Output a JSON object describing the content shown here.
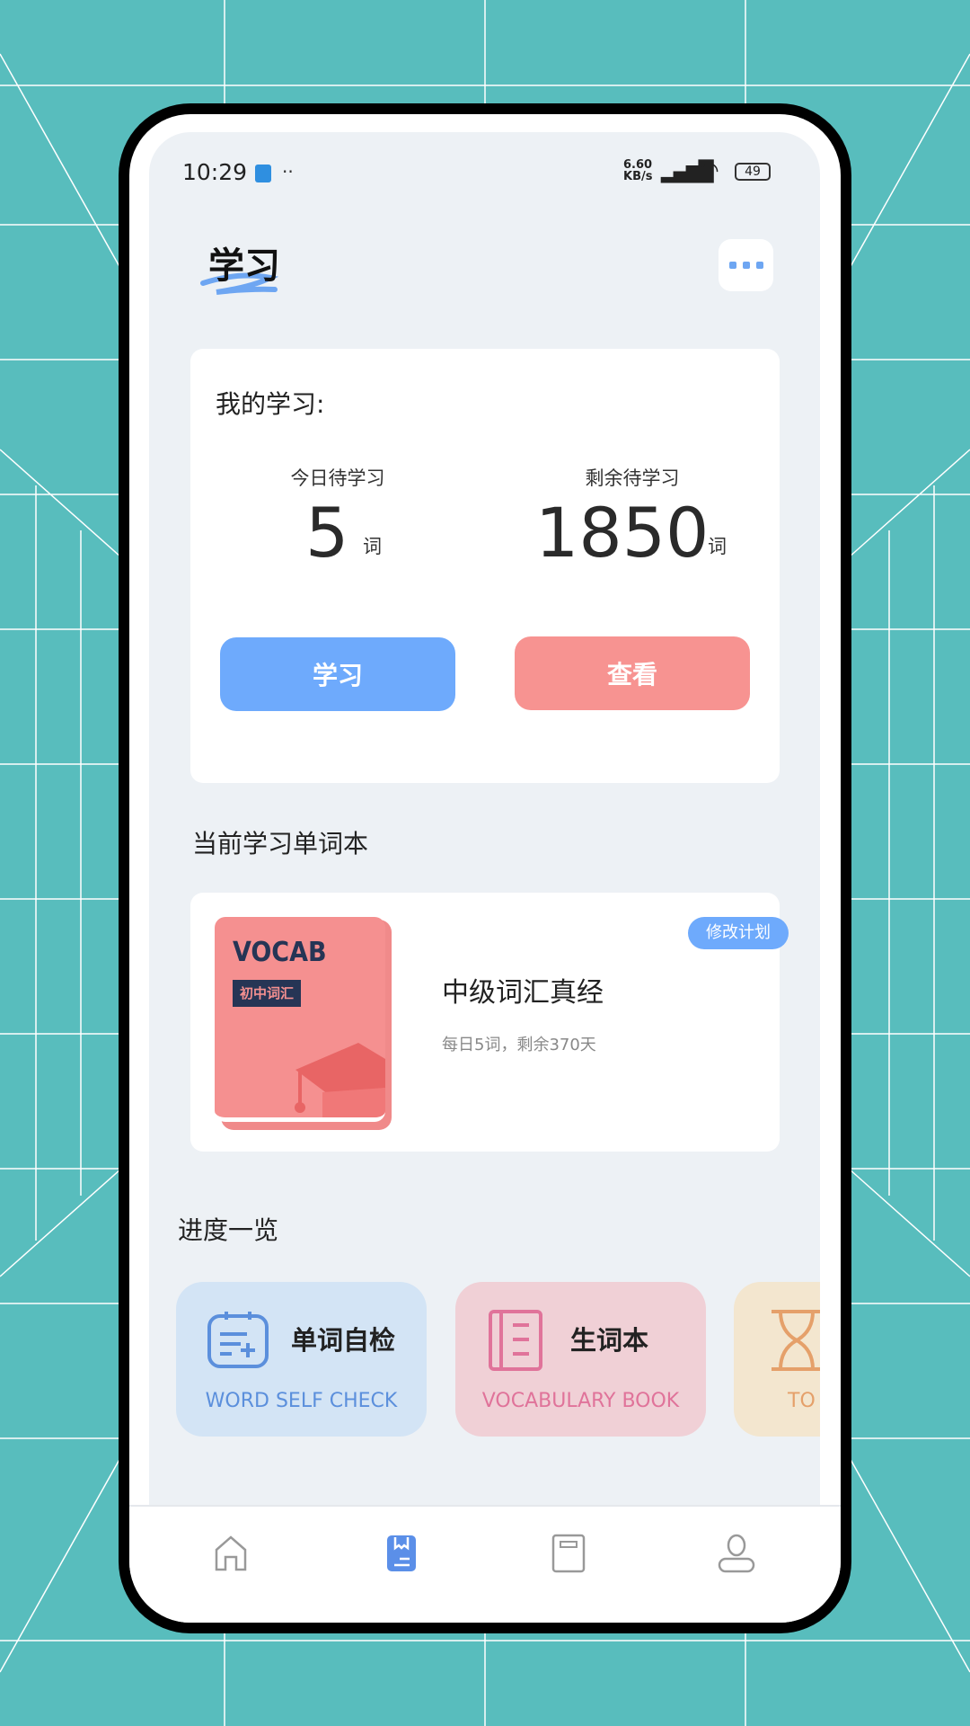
{
  "status_bar": {
    "time": "10:29",
    "speed": "6.60",
    "speed_unit": "KB/s",
    "battery": "49"
  },
  "header": {
    "title": "学习",
    "more_icon": "ellipsis-icon"
  },
  "study": {
    "heading": "我的学习:",
    "today_label": "今日待学习",
    "today_value": "5",
    "today_unit": "词",
    "remain_label": "剩余待学习",
    "remain_value": "1850",
    "remain_unit": "词",
    "study_button": "学习",
    "view_button": "查看"
  },
  "wordbook": {
    "section_title": "当前学习单词本",
    "cover_title": "VOCAB",
    "cover_subtitle": "初中词汇",
    "name": "中级词汇真经",
    "plan": "每日5词，剩余370天",
    "edit_button": "修改计划"
  },
  "progress": {
    "section_title": "进度一览",
    "tiles": [
      {
        "title": "单词自检",
        "subtitle": "WORD SELF CHECK",
        "icon": "calendar-plus-icon",
        "color": "#5b8fdc",
        "bg": "#d3e4f5"
      },
      {
        "title": "生词本",
        "subtitle": "VOCABULARY BOOK",
        "icon": "notebook-icon",
        "color": "#e0739a",
        "bg": "#f0d0d6"
      },
      {
        "title": "",
        "subtitle": "TO",
        "icon": "hourglass-icon",
        "color": "#e5a06a",
        "bg": "#f3e6cf"
      }
    ]
  },
  "nav": {
    "items": [
      {
        "icon": "home-icon"
      },
      {
        "icon": "wordbook-icon",
        "active": true
      },
      {
        "icon": "book-icon"
      },
      {
        "icon": "profile-icon"
      }
    ]
  },
  "colors": {
    "accent": "#6eaafc",
    "view": "#f79391",
    "background": "#edf1f5"
  }
}
